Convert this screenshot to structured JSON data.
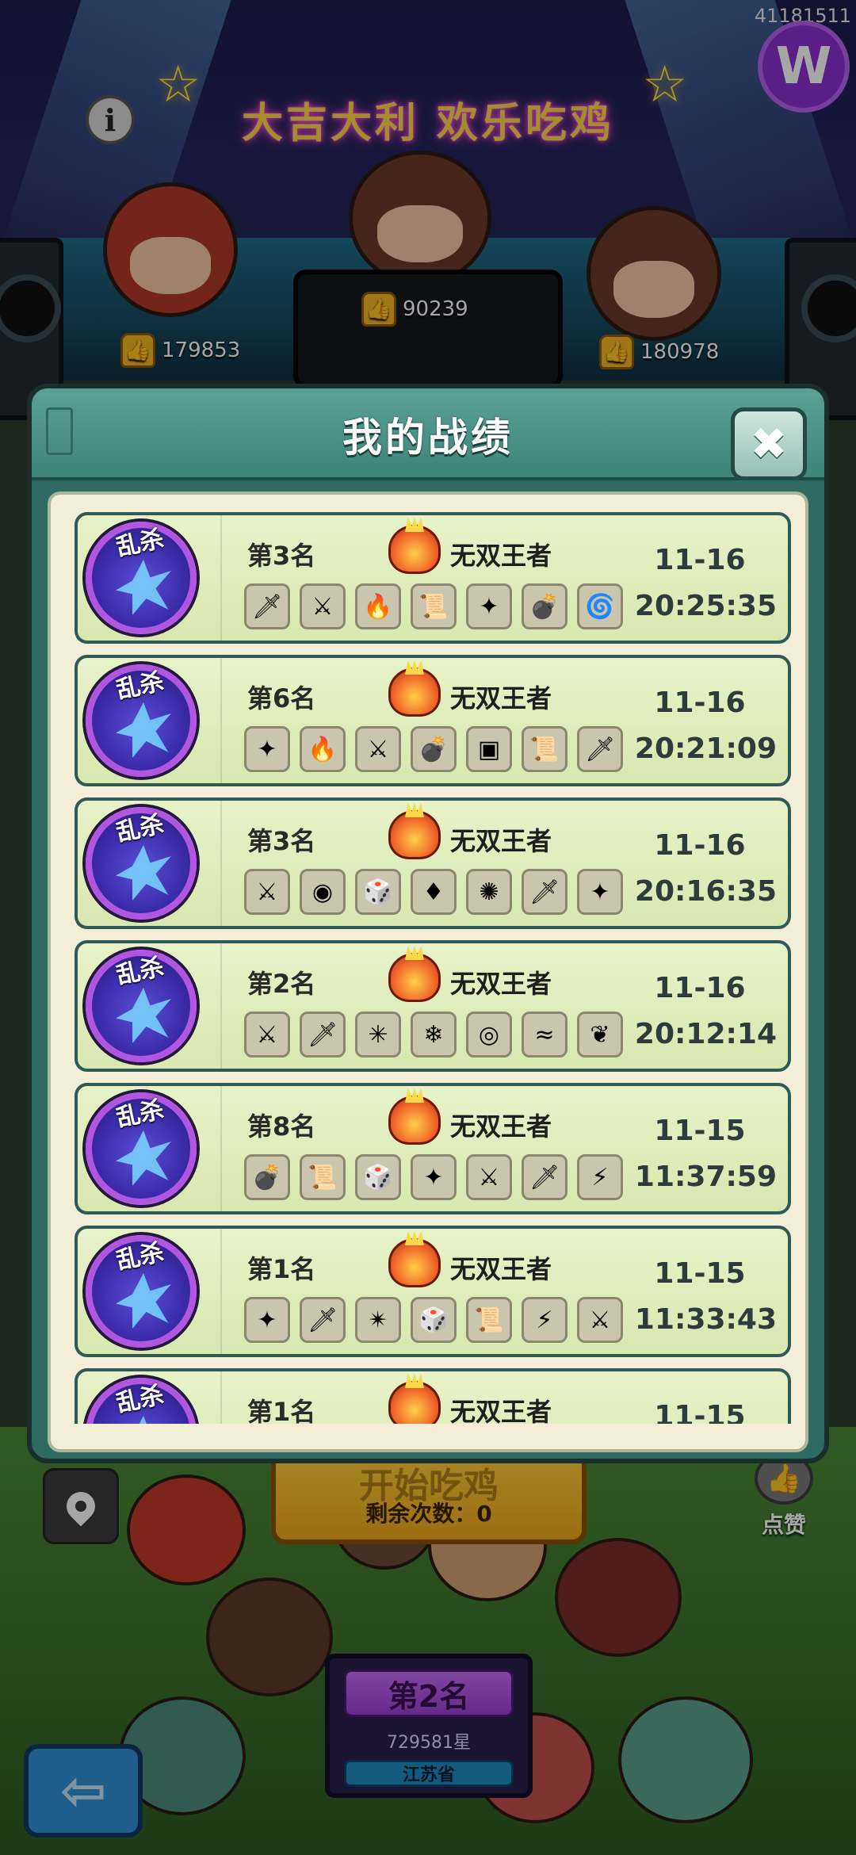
{
  "header": {
    "neon_title": "大吉大利 欢乐吃鸡",
    "corner_id": "41181511"
  },
  "podium": {
    "likes_left": "179853",
    "likes_center": "90239",
    "likes_right": "180978"
  },
  "modal": {
    "title": "我的战绩",
    "close_symbol": "✖",
    "mode_label": "乱杀",
    "records": [
      {
        "rank": "第3名",
        "tier": "无双王者",
        "date": "11-16",
        "time": "20:25:35",
        "items": [
          "sword-gold-icon",
          "ice-sword-icon",
          "fire-armor-icon",
          "scroll-icon",
          "ice-staff-icon",
          "skull-bomb-icon",
          "fire-ring-icon"
        ]
      },
      {
        "rank": "第6名",
        "tier": "无双王者",
        "date": "11-16",
        "time": "20:21:09",
        "items": [
          "ice-staff-icon",
          "fire-armor-icon",
          "ice-sword-icon",
          "skull-bomb-icon",
          "purple-box-icon",
          "scroll-icon",
          "sword-gold-icon"
        ]
      },
      {
        "rank": "第3名",
        "tier": "无双王者",
        "date": "11-16",
        "time": "20:16:35",
        "items": [
          "ice-sword-icon",
          "purple-orb-icon",
          "dice-icon",
          "red-crystal-icon",
          "fire-burst-icon",
          "sword-gold-icon",
          "ice-staff-icon"
        ]
      },
      {
        "rank": "第2名",
        "tier": "无双王者",
        "date": "11-16",
        "time": "20:12:14",
        "items": [
          "ice-sword-icon",
          "sword-gold-icon",
          "ice-shard-icon",
          "ice-armor-icon",
          "ice-vortex-icon",
          "water-wave-icon",
          "green-leaf-icon"
        ]
      },
      {
        "rank": "第8名",
        "tier": "无双王者",
        "date": "11-15",
        "time": "11:37:59",
        "items": [
          "skull-bomb-icon",
          "scroll-icon",
          "dice-icon",
          "ice-staff-icon",
          "ice-sword-icon",
          "sword-gold-icon",
          "fire-slash-icon"
        ]
      },
      {
        "rank": "第1名",
        "tier": "无双王者",
        "date": "11-15",
        "time": "11:33:43",
        "items": [
          "ice-staff-icon",
          "sword-gold-icon",
          "ice-burst-icon",
          "dice-icon",
          "scroll-icon",
          "fire-slash-icon",
          "ice-sword-icon"
        ]
      },
      {
        "rank": "第1名",
        "tier": "无双王者",
        "date": "11-15",
        "time": "",
        "items": []
      }
    ]
  },
  "footer": {
    "start_label": "开始吃鸡",
    "remaining": "剩余次数：0",
    "like_label": "点赞",
    "rank_title": "第2名",
    "rank_stars": "729581星",
    "rank_region": "江苏省"
  },
  "colors": {
    "accent_modal": "#2f6a62",
    "record_bg": "#e8f2c8",
    "text_dark": "#2e3b3c"
  }
}
